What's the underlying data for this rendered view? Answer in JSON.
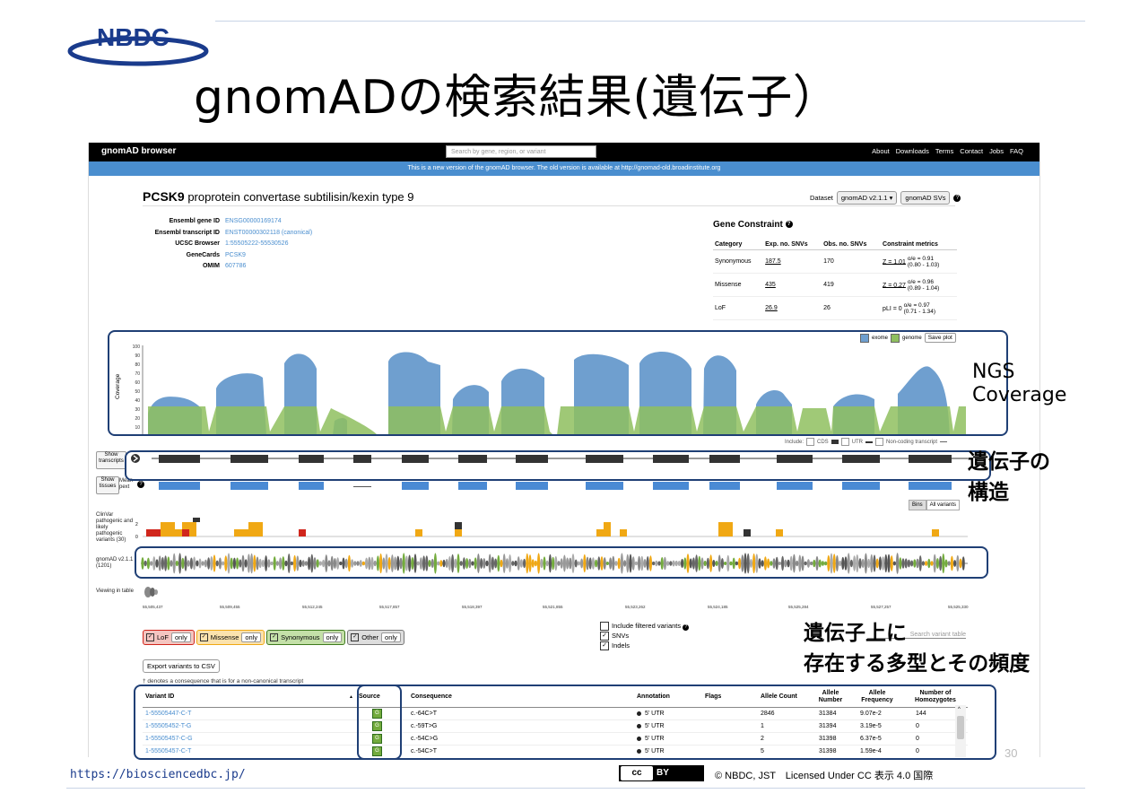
{
  "slide": {
    "logo_text": "NBDC",
    "title": "gnomADの検索結果(遺伝子）",
    "footer_url": "https://biosciencedbc.jp/",
    "cc_icon": "cc",
    "cc_by": "BY",
    "license": "© NBDC, JST　Licensed Under CC 表示 4.0 国際",
    "page_number": "30",
    "colors": {
      "logo_blue": "#1a3b8c",
      "annotation": "#1f3f75"
    }
  },
  "annotations": {
    "coverage": "NGS\nCoverage",
    "structure": "遺伝子の\n構造",
    "variants": "遺伝子上に\n存在する多型とその頻度"
  },
  "browser": {
    "brand": "gnomAD browser",
    "search_placeholder": "Search by gene, region, or variant",
    "nav": [
      "About",
      "Downloads",
      "Terms",
      "Contact",
      "Jobs",
      "FAQ"
    ],
    "banner": "This is a new version of the gnomAD browser. The old version is available at http://gnomad-old.broadinstitute.org",
    "colors": {
      "navbar": "#000000",
      "banner": "#4a8ecf",
      "exome": "#6f9fcf",
      "genome": "#8fbf5f",
      "lof": "#d0261c",
      "missense": "#f0a814",
      "synonymous": "#73ab3d"
    }
  },
  "gene": {
    "symbol": "PCSK9",
    "name": "proprotein convertase subtilisin/kexin type 9",
    "dataset_label": "Dataset",
    "dataset_value": "gnomAD v2.1.1",
    "dataset_alt": "gnomAD SVs",
    "info": [
      {
        "key": "Ensembl gene ID",
        "value": "ENSG00000169174"
      },
      {
        "key": "Ensembl transcript ID",
        "value": "ENST00000302118 (canonical)"
      },
      {
        "key": "UCSC Browser",
        "value": "1:55505222-55530526"
      },
      {
        "key": "GeneCards",
        "value": "PCSK9"
      },
      {
        "key": "OMIM",
        "value": "607786"
      }
    ]
  },
  "constraint": {
    "title": "Gene Constraint",
    "headers": [
      "Category",
      "Exp. no. SNVs",
      "Obs. no. SNVs",
      "Constraint metrics"
    ],
    "rows": [
      {
        "category": "Synonymous",
        "exp": "187.5",
        "obs": "170",
        "metric": "Z = 1.01",
        "oe": "o/e = 0.91",
        "ci": "(0.80 - 1.03)"
      },
      {
        "category": "Missense",
        "exp": "435",
        "obs": "419",
        "metric": "Z = 0.27",
        "oe": "o/e = 0.96",
        "ci": "(0.89 - 1.04)"
      },
      {
        "category": "LoF",
        "exp": "26.9",
        "obs": "26",
        "metric": "pLI = 0",
        "oe": "o/e = 0.97",
        "ci": "(0.71 - 1.34)"
      }
    ]
  },
  "coverage": {
    "ylabel": "Coverage",
    "ticks": [
      "100",
      "90",
      "80",
      "70",
      "60",
      "50",
      "40",
      "30",
      "20",
      "10"
    ],
    "legend_exome": "exome",
    "legend_genome": "genome",
    "save": "Save plot",
    "include_label": "Include:",
    "include_cds": "CDS",
    "include_utr": "UTR",
    "include_noncoding": "Non-coding transcript"
  },
  "tracks": {
    "show_transcripts": "Show transcripts",
    "show_tissues": "Show tissues",
    "mean_pext": "Mean pext",
    "clinvar_label": "ClinVar pathogenic and likely pathogenic variants (30)",
    "clinvar_tick_top": "2",
    "clinvar_tick_bottom": "0",
    "bins": "Bins",
    "all_variants": "All variants",
    "gnomad_label": "gnomAD v2.1.1 (1201)",
    "viewing_label": "Viewing in table",
    "positions": [
      "55,505,437",
      "55,509,455",
      "55,512,245",
      "55,517,857",
      "55,518,397",
      "55,521,855",
      "55,523,262",
      "55,524,185",
      "55,525,284",
      "55,527,257",
      "55,525,330"
    ]
  },
  "filters": {
    "lof": "LoF",
    "missense": "Missense",
    "synonymous": "Synonymous",
    "other": "Other",
    "only": "only",
    "check_mark": "✓",
    "include_filtered": "Include filtered variants",
    "snvs": "SNVs",
    "indels": "Indels",
    "export": "Export variants to CSV",
    "footnote": "† denotes a consequence that is for a non-canonical transcript",
    "search_table": "Search variant table"
  },
  "table": {
    "headers": {
      "variant_id": "Variant ID",
      "sort_arrow": "▲",
      "source": "Source",
      "consequence": "Consequence",
      "annotation": "Annotation",
      "flags": "Flags",
      "allele_count": "Allele Count",
      "allele_number": "Allele Number",
      "allele_frequency": "Allele Frequency",
      "homozygotes": "Number of Homozygotes"
    },
    "rows": [
      {
        "id": "1-55505447-C-T",
        "source": "G",
        "consequence": "c.-64C>T",
        "annotation": "5' UTR",
        "flags": "",
        "ac": "2846",
        "an": "31384",
        "af": "9.07e-2",
        "hom": "144"
      },
      {
        "id": "1-55505452-T-G",
        "source": "G",
        "consequence": "c.-59T>G",
        "annotation": "5' UTR",
        "flags": "",
        "ac": "1",
        "an": "31394",
        "af": "3.19e-5",
        "hom": "0"
      },
      {
        "id": "1-55505457-C-G",
        "source": "G",
        "consequence": "c.-54C>G",
        "annotation": "5' UTR",
        "flags": "",
        "ac": "2",
        "an": "31398",
        "af": "6.37e-5",
        "hom": "0"
      },
      {
        "id": "1-55505457-C-T",
        "source": "G",
        "consequence": "c.-54C>T",
        "annotation": "5' UTR",
        "flags": "",
        "ac": "5",
        "an": "31398",
        "af": "1.59e-4",
        "hom": "0"
      }
    ]
  }
}
